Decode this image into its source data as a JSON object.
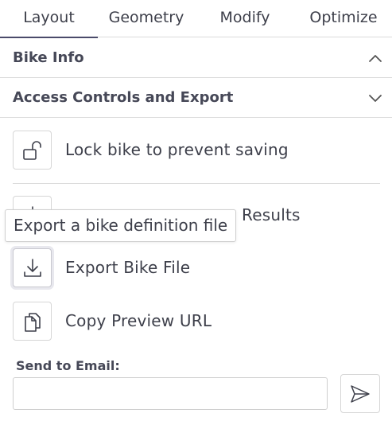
{
  "tabs": [
    {
      "label": "Layout",
      "active": true
    },
    {
      "label": "Geometry",
      "active": false
    },
    {
      "label": "Modify",
      "active": false
    },
    {
      "label": "Optimize",
      "active": false
    }
  ],
  "sections": {
    "bike_info": {
      "title": "Bike Info",
      "expanded": false,
      "chevron": "chevron-up-icon"
    },
    "access_controls": {
      "title": "Access Controls and Export",
      "expanded": true,
      "chevron": "chevron-down-icon"
    }
  },
  "actions": {
    "lock": {
      "label": "Lock bike to prevent saving",
      "icon": "unlock-icon"
    },
    "export_results": {
      "label_visible_fragment": "Results",
      "icon": "download-icon"
    },
    "export_bike_file": {
      "label": "Export Bike File",
      "icon": "download-icon"
    },
    "copy_preview_url": {
      "label": "Copy Preview URL",
      "icon": "copy-icon"
    }
  },
  "tooltip": {
    "text": "Export a bike definition file"
  },
  "email": {
    "label": "Send to Email:",
    "value": "",
    "placeholder": "",
    "send_icon": "send-icon"
  },
  "colors": {
    "text": "#3d3f4a",
    "border": "#dadada",
    "active_tab_underline": "#4a4b6a"
  }
}
